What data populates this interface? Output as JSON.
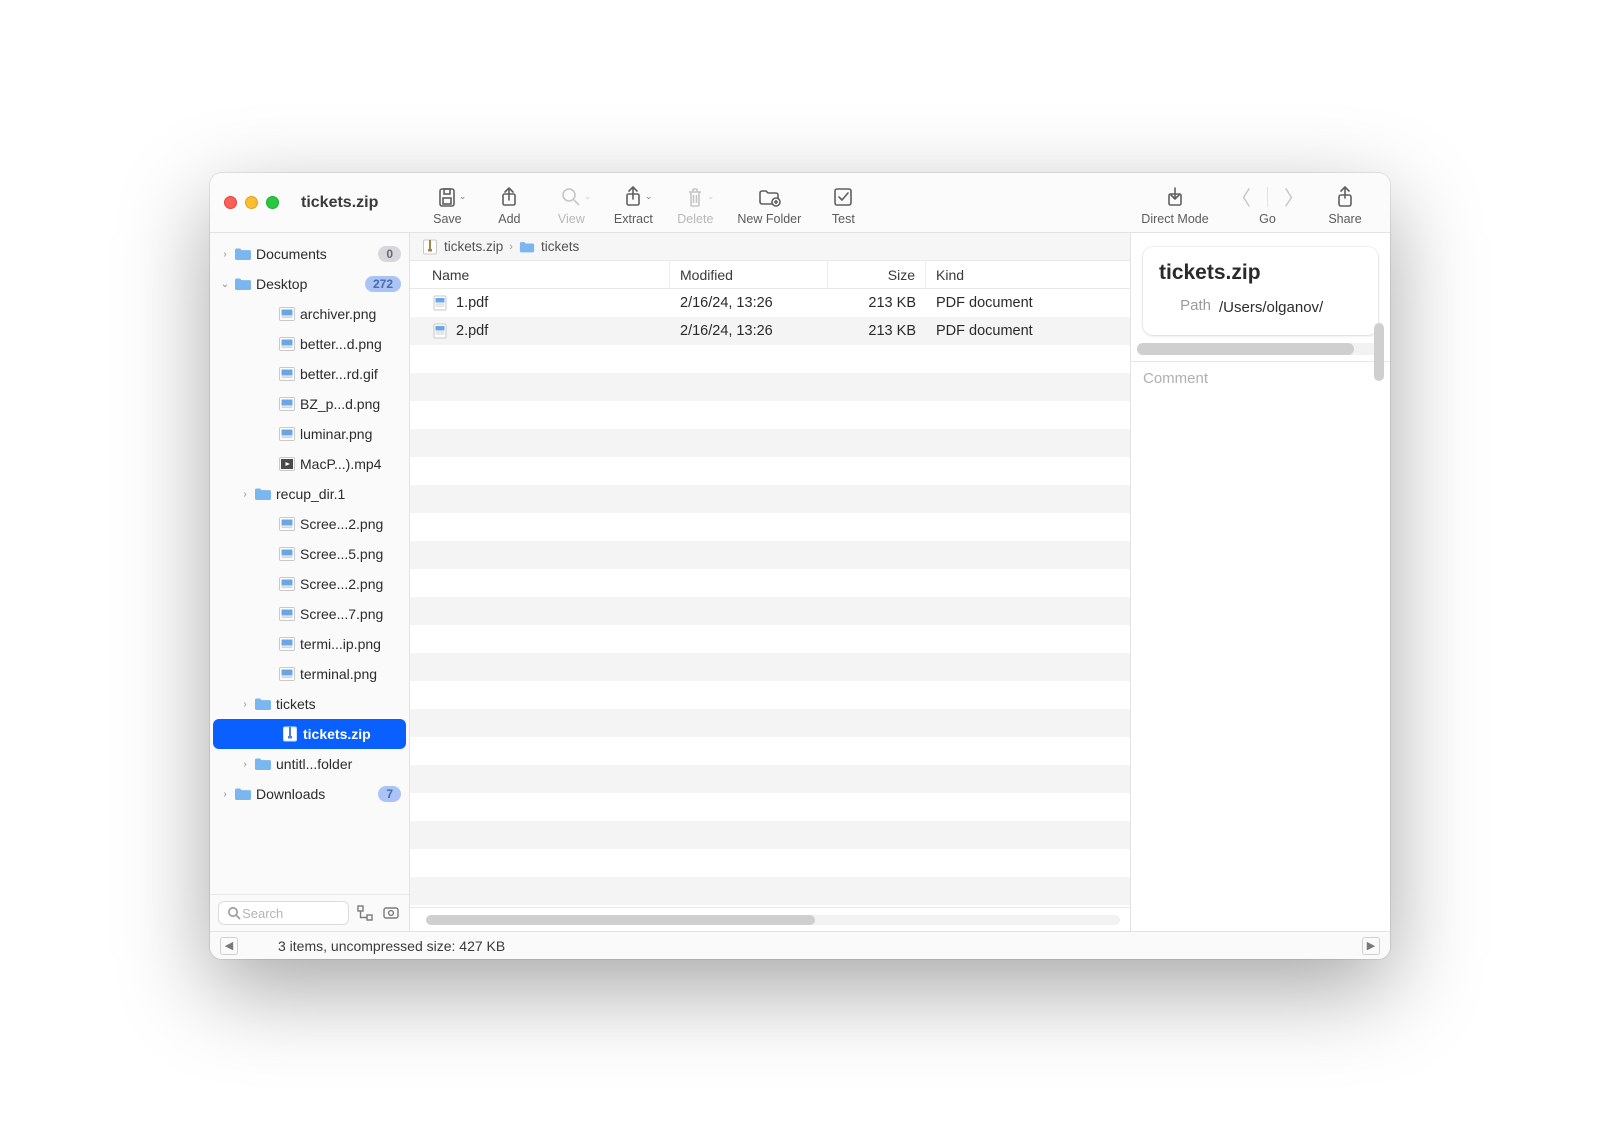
{
  "window": {
    "title": "tickets.zip"
  },
  "toolbar": {
    "save": {
      "label": "Save",
      "disabled": false,
      "chevron": true
    },
    "add": {
      "label": "Add",
      "disabled": false,
      "chevron": false
    },
    "view": {
      "label": "View",
      "disabled": true,
      "chevron": true
    },
    "extract": {
      "label": "Extract",
      "disabled": false,
      "chevron": true
    },
    "delete": {
      "label": "Delete",
      "disabled": true,
      "chevron": true
    },
    "newfolder": {
      "label": "New Folder",
      "disabled": false,
      "chevron": false
    },
    "test": {
      "label": "Test",
      "disabled": false,
      "chevron": false
    },
    "direct": {
      "label": "Direct Mode",
      "disabled": false,
      "chevron": false
    },
    "go": {
      "label": "Go",
      "disabled": false
    },
    "share": {
      "label": "Share",
      "disabled": false,
      "chevron": false
    }
  },
  "sidebar": {
    "search_placeholder": "Search",
    "items": [
      {
        "depth": 0,
        "disclosure": "›",
        "icon": "folder",
        "label": "Documents",
        "badge": "0",
        "badge_style": "grey"
      },
      {
        "depth": 0,
        "disclosure": "⌄",
        "icon": "folder",
        "label": "Desktop",
        "badge": "272",
        "badge_style": "blue"
      },
      {
        "depth": 2,
        "disclosure": "",
        "icon": "image",
        "label": "archiver.png"
      },
      {
        "depth": 2,
        "disclosure": "",
        "icon": "image",
        "label": "better...d.png"
      },
      {
        "depth": 2,
        "disclosure": "",
        "icon": "image",
        "label": "better...rd.gif"
      },
      {
        "depth": 2,
        "disclosure": "",
        "icon": "image",
        "label": "BZ_p...d.png"
      },
      {
        "depth": 2,
        "disclosure": "",
        "icon": "image",
        "label": "luminar.png"
      },
      {
        "depth": 2,
        "disclosure": "",
        "icon": "video",
        "label": "MacP...).mp4"
      },
      {
        "depth": 1,
        "disclosure": "›",
        "icon": "folder",
        "label": "recup_dir.1"
      },
      {
        "depth": 2,
        "disclosure": "",
        "icon": "image",
        "label": "Scree...2.png"
      },
      {
        "depth": 2,
        "disclosure": "",
        "icon": "image",
        "label": "Scree...5.png"
      },
      {
        "depth": 2,
        "disclosure": "",
        "icon": "image",
        "label": "Scree...2.png"
      },
      {
        "depth": 2,
        "disclosure": "",
        "icon": "image",
        "label": "Scree...7.png"
      },
      {
        "depth": 2,
        "disclosure": "",
        "icon": "image",
        "label": "termi...ip.png"
      },
      {
        "depth": 2,
        "disclosure": "",
        "icon": "image",
        "label": "terminal.png"
      },
      {
        "depth": 1,
        "disclosure": "›",
        "icon": "folder",
        "label": "tickets"
      },
      {
        "depth": 2,
        "disclosure": "",
        "icon": "archive",
        "label": "tickets.zip",
        "selected": true
      },
      {
        "depth": 1,
        "disclosure": "›",
        "icon": "folder",
        "label": "untitl...folder"
      },
      {
        "depth": 0,
        "disclosure": "›",
        "icon": "folder",
        "label": "Downloads",
        "badge": "7",
        "badge_style": "blue"
      }
    ]
  },
  "breadcrumb": [
    {
      "icon": "archive",
      "label": "tickets.zip"
    },
    {
      "icon": "folder",
      "label": "tickets"
    }
  ],
  "columns": {
    "name": "Name",
    "modified": "Modified",
    "size": "Size",
    "kind": "Kind"
  },
  "files": [
    {
      "icon": "pdf",
      "name": "1.pdf",
      "modified": "2/16/24, 13:26",
      "size": "213 KB",
      "kind": "PDF document"
    },
    {
      "icon": "pdf",
      "name": "2.pdf",
      "modified": "2/16/24, 13:26",
      "size": "213 KB",
      "kind": "PDF document"
    }
  ],
  "empty_rows": 20,
  "info": {
    "title": "tickets.zip",
    "path_label": "Path",
    "path_value": "/Users/olganov/",
    "comment_placeholder": "Comment"
  },
  "status": "3 items, uncompressed size: 427 KB"
}
